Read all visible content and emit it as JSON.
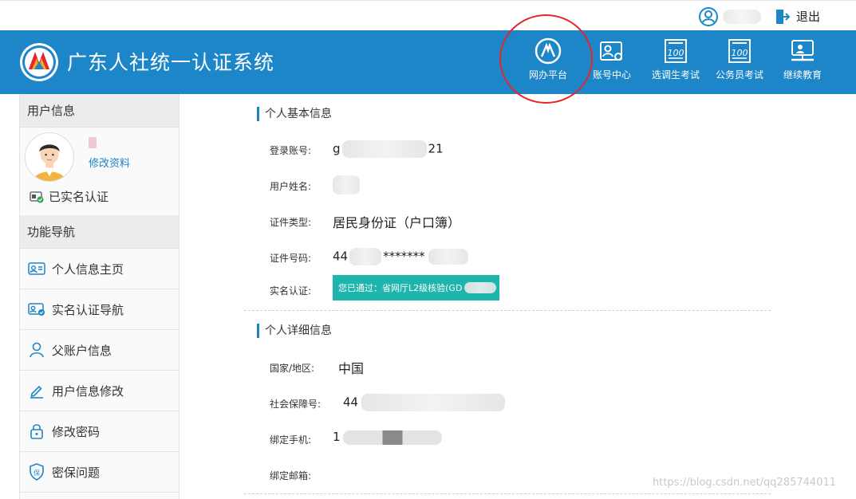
{
  "utility": {
    "logout_label": "退出"
  },
  "header": {
    "site_title": "广东人社统一认证系统",
    "nav": [
      {
        "label": "网办平台",
        "icon": "service-platform-icon"
      },
      {
        "label": "账号中心",
        "icon": "account-center-icon"
      },
      {
        "label": "选调生考试",
        "icon": "exam-score-icon"
      },
      {
        "label": "公务员考试",
        "icon": "exam-score-icon"
      },
      {
        "label": "继续教育",
        "icon": "education-icon"
      }
    ]
  },
  "sidebar": {
    "user_heading": "用户信息",
    "edit_profile": "修改资料",
    "verified_label": "已实名认证",
    "nav_heading": "功能导航",
    "items": [
      {
        "label": "个人信息主页",
        "icon": "id-card-icon"
      },
      {
        "label": "实名认证导航",
        "icon": "verify-card-icon"
      },
      {
        "label": "父账户信息",
        "icon": "user-icon"
      },
      {
        "label": "用户信息修改",
        "icon": "edit-icon"
      },
      {
        "label": "修改密码",
        "icon": "lock-icon"
      },
      {
        "label": "密保问题",
        "icon": "shield-icon"
      }
    ]
  },
  "main": {
    "basic_title": "个人基本信息",
    "basic": {
      "account_label": "登录账号:",
      "account_prefix": "g",
      "account_suffix": "21",
      "name_label": "用户姓名:",
      "idtype_label": "证件类型:",
      "idtype_value": "居民身份证（户口簿）",
      "idno_label": "证件号码:",
      "idno_prefix": "44",
      "idno_mask": "*******",
      "verify_label": "实名认证:",
      "verify_value": "您已通过：省网厅L2级核验(GD"
    },
    "detail_title": "个人详细信息",
    "detail": {
      "country_label": "国家/地区:",
      "country_value": "中国",
      "ssn_label": "社会保障号:",
      "ssn_prefix": "44",
      "phone_label": "绑定手机:",
      "phone_prefix": "1",
      "email_label": "绑定邮箱:"
    }
  },
  "watermark": "https://blog.csdn.net/qq285744011",
  "colors": {
    "header_bg": "#1c86c8",
    "badge_bg": "#1fb5ad",
    "highlight": "#e3262c"
  }
}
